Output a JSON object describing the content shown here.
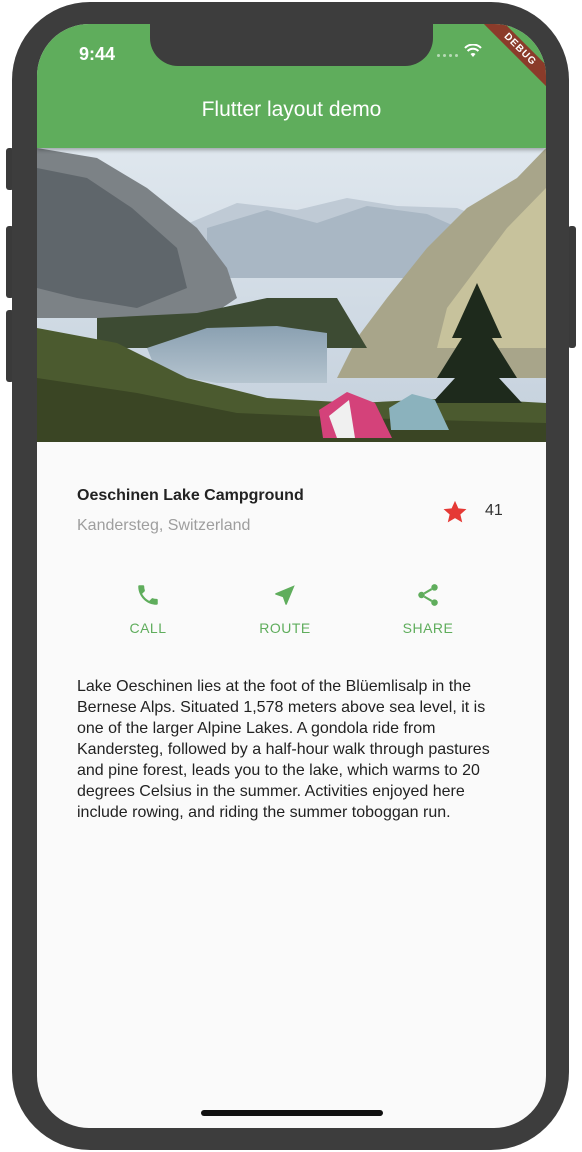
{
  "status_bar": {
    "time": "9:44"
  },
  "app_bar": {
    "title": "Flutter layout demo",
    "debug_banner": "DEBUG"
  },
  "place": {
    "name": "Oeschinen Lake Campground",
    "location": "Kandersteg, Switzerland",
    "rating_count": "41"
  },
  "actions": [
    {
      "label": "CALL",
      "icon": "phone-icon"
    },
    {
      "label": "ROUTE",
      "icon": "navigation-icon"
    },
    {
      "label": "SHARE",
      "icon": "share-icon"
    }
  ],
  "description": "Lake Oeschinen lies at the foot of the Blüemlisalp in the Bernese Alps. Situated 1,578 meters above sea level, it is one of the larger Alpine Lakes. A gondola ride from Kandersteg, followed by a half-hour walk through pastures and pine forest, leads you to the lake, which warms to 20 degrees Celsius in the summer. Activities enjoyed here include rowing, and riding the summer toboggan run.",
  "colors": {
    "primary": "#5fad5c",
    "star": "#e53935",
    "debug": "#8b3b2a"
  }
}
